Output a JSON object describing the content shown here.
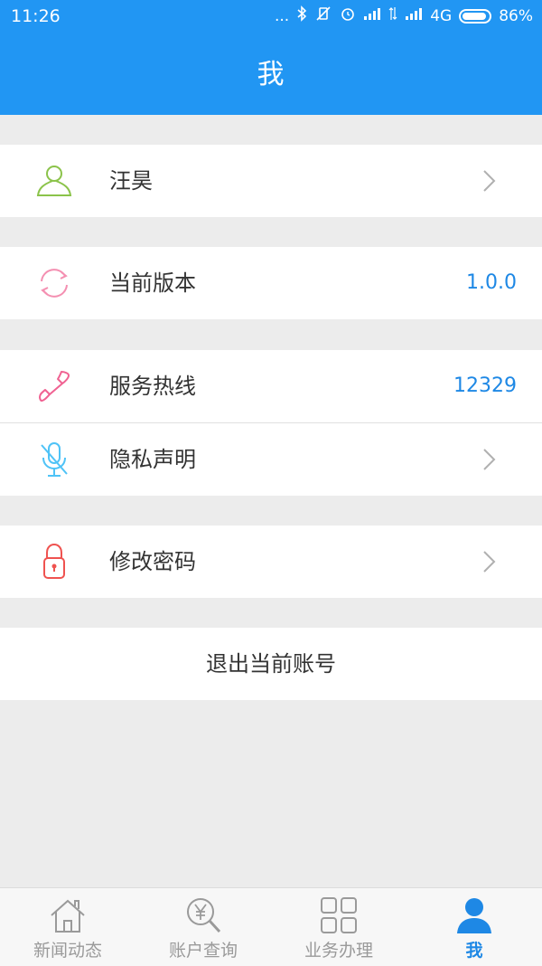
{
  "status_bar": {
    "time": "11:26",
    "dots": "...",
    "network": "4G",
    "battery": "86%"
  },
  "header": {
    "title": "我"
  },
  "rows": [
    {
      "label": "汪昊",
      "value": "",
      "icon": "user-icon"
    },
    {
      "label": "当前版本",
      "value": "1.0.0",
      "icon": "refresh-icon"
    },
    {
      "label": "服务热线",
      "value": "12329",
      "icon": "phone-icon"
    },
    {
      "label": "隐私声明",
      "value": "",
      "icon": "mic-off-icon"
    },
    {
      "label": "修改密码",
      "value": "",
      "icon": "lock-icon"
    }
  ],
  "logout_label": "退出当前账号",
  "tabs": [
    {
      "label": "新闻动态",
      "icon": "home-icon"
    },
    {
      "label": "账户查询",
      "icon": "search-yen-icon"
    },
    {
      "label": "业务办理",
      "icon": "grid-icon"
    },
    {
      "label": "我",
      "icon": "person-icon",
      "active": true
    }
  ],
  "colors": {
    "primary": "#2196f3",
    "link_value": "#1e88e5",
    "user_icon": "#8bc34a",
    "refresh_icon": "#f48fb1",
    "phone_icon": "#f06292",
    "mic_icon": "#4fc3f7",
    "lock_icon": "#ef5350"
  }
}
